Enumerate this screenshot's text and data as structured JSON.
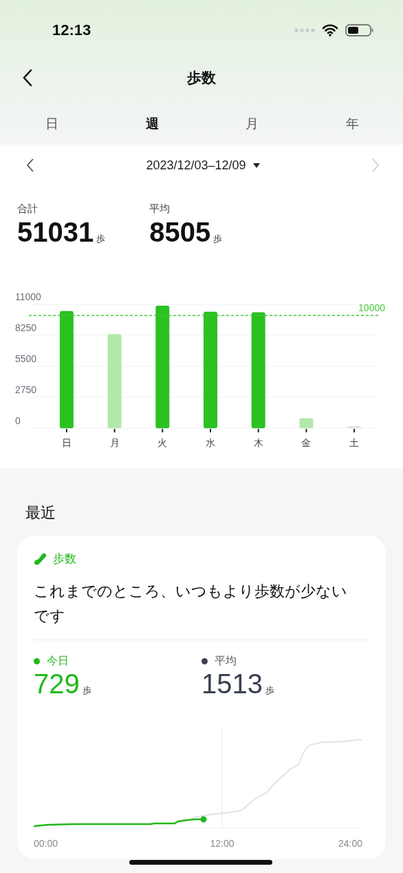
{
  "status_bar": {
    "time": "12:13"
  },
  "nav": {
    "title": "歩数"
  },
  "tabs": [
    {
      "label": "日",
      "selected": false
    },
    {
      "label": "週",
      "selected": true
    },
    {
      "label": "月",
      "selected": false
    },
    {
      "label": "年",
      "selected": false
    }
  ],
  "period": {
    "range": "2023/12/03–12/09",
    "next_disabled": true
  },
  "stats": [
    {
      "label": "合計",
      "value": "51031",
      "unit": "歩"
    },
    {
      "label": "平均",
      "value": "8505",
      "unit": "歩"
    }
  ],
  "weekly_chart": {
    "chart_data": {
      "type": "bar",
      "categories": [
        "日",
        "月",
        "火",
        "水",
        "木",
        "金",
        "土"
      ],
      "series": [
        {
          "color": "#2ac221",
          "values": [
            10400,
            null,
            10880,
            10350,
            10300,
            null,
            null
          ]
        },
        {
          "color": "#b2e8ab",
          "values": [
            null,
            8350,
            null,
            null,
            null,
            880,
            null
          ]
        },
        {
          "color": "#dfe3ea",
          "values": [
            null,
            null,
            null,
            null,
            null,
            null,
            200
          ]
        }
      ],
      "grid": true,
      "ylim": [
        0,
        11000
      ],
      "yticks": [
        0,
        2750,
        5500,
        8250,
        11000
      ],
      "ref_lines": [
        {
          "axis": "y",
          "value": 10000,
          "label": "10000",
          "color": "#44cc3a"
        }
      ]
    }
  },
  "recent": {
    "heading": "最近",
    "card": {
      "category": "歩数",
      "message": "これまでのところ、いつもより歩数が少ないです",
      "legend": [
        {
          "label": "今日",
          "value": "729",
          "unit": "歩",
          "color": "#22b81b"
        },
        {
          "label": "平均",
          "value": "1513",
          "unit": "歩",
          "color": "#3a4152"
        }
      ],
      "time_labels": [
        "00:00",
        "12:00",
        "24:00"
      ]
    }
  }
}
